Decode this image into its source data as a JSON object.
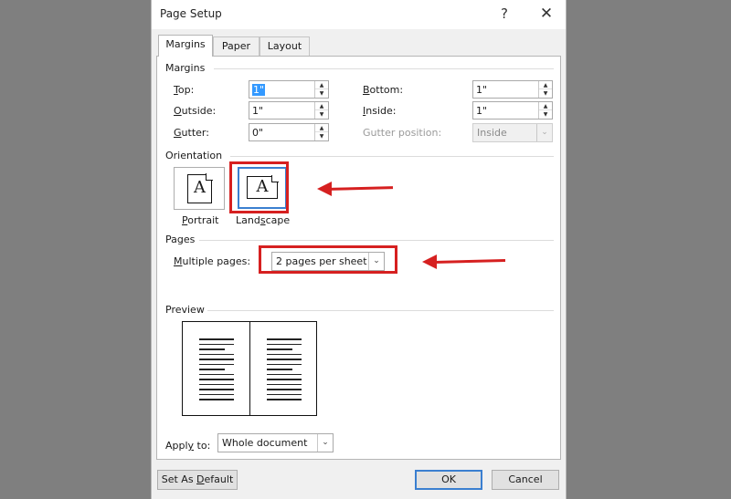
{
  "window": {
    "title": "Page Setup",
    "help_glyph": "?",
    "close_glyph": "✕"
  },
  "tabs": [
    {
      "label": "Margins",
      "active": true
    },
    {
      "label": "Paper",
      "active": false
    },
    {
      "label": "Layout",
      "active": false
    }
  ],
  "margins": {
    "section_label": "Margins",
    "top": {
      "label_pre": "",
      "label_key": "T",
      "label_post": "op:",
      "value": "1\""
    },
    "bottom": {
      "label_pre": "",
      "label_key": "B",
      "label_post": "ottom:",
      "value": "1\""
    },
    "outside": {
      "label_pre": "",
      "label_key": "O",
      "label_post": "utside:",
      "value": "1\""
    },
    "inside": {
      "label_pre": "",
      "label_key": "I",
      "label_post": "nside:",
      "value": "1\""
    },
    "gutter": {
      "label_pre": "",
      "label_key": "G",
      "label_post": "utter:",
      "value": "0\""
    },
    "gutter_position": {
      "label": "Gutter position:",
      "value": "Inside"
    }
  },
  "orientation": {
    "section_label": "Orientation",
    "portrait": {
      "label_pre": "",
      "label_key": "P",
      "label_post": "ortrait",
      "glyph": "A"
    },
    "landscape": {
      "label_pre": "Land",
      "label_key": "s",
      "label_post": "cape",
      "glyph": "A",
      "selected": true
    }
  },
  "pages": {
    "section_label": "Pages",
    "multiple_pages": {
      "label_pre": "",
      "label_key": "M",
      "label_post": "ultiple pages:",
      "value": "2 pages per sheet"
    }
  },
  "preview": {
    "section_label": "Preview"
  },
  "apply_to": {
    "label_pre": "Appl",
    "label_key": "y",
    "label_post": " to:",
    "value": "Whole document"
  },
  "buttons": {
    "set_default": {
      "label_pre": "Set As ",
      "label_key": "D",
      "label_post": "efault"
    },
    "ok": "OK",
    "cancel": "Cancel"
  },
  "annotations": {
    "highlight_color": "#d62020"
  },
  "icons": {
    "spin_up": "▲",
    "spin_down": "▼",
    "dropdown": "⌄"
  }
}
